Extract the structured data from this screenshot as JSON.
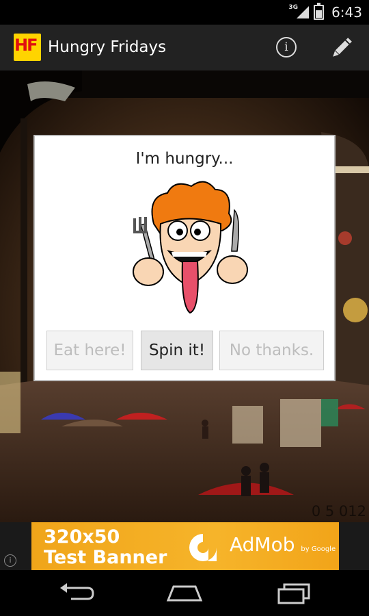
{
  "status_bar": {
    "network": "3G",
    "time": "6:43"
  },
  "action_bar": {
    "logo_text": "HF",
    "title": "Hungry Fridays",
    "info_icon": "info-icon",
    "edit_icon": "pencil-icon"
  },
  "dialog": {
    "title": "I'm hungry...",
    "image": "hungry-cartoon-man-with-fork-and-knife",
    "buttons": {
      "eat": "Eat here!",
      "spin": "Spin it!",
      "no": "No thanks."
    }
  },
  "background": {
    "timestamp": "0 5 012"
  },
  "ad": {
    "line1": "320x50",
    "line2": "Test Banner",
    "brand": "AdMob",
    "brand_sub": "by Google",
    "info_icon": "info-icon"
  },
  "nav_bar": {
    "back_icon": "back-icon",
    "home_icon": "home-icon",
    "recents_icon": "recents-icon"
  },
  "colors": {
    "action_bar": "#222222",
    "logo_bg": "#ffd400",
    "logo_text": "#e01010",
    "ad_bg": "#f4ac22"
  }
}
